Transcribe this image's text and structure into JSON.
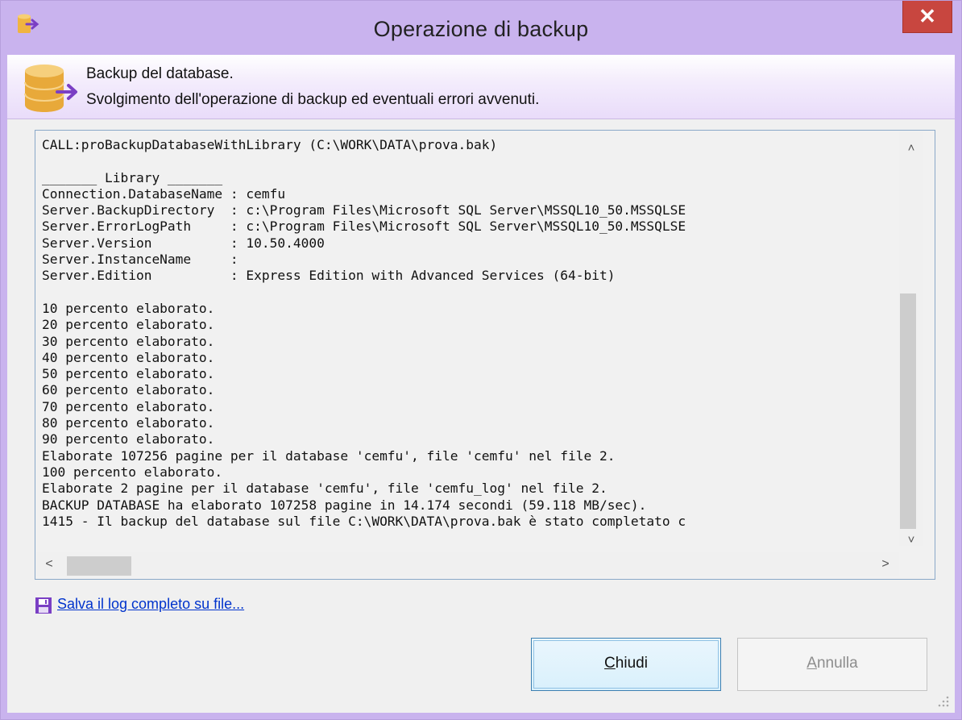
{
  "window": {
    "title": "Operazione di backup",
    "close_label": "✕"
  },
  "header": {
    "title": "Backup del database.",
    "subtitle": "Svolgimento dell'operazione di backup ed eventuali errori avvenuti."
  },
  "log": {
    "text": "CALL:proBackupDatabaseWithLibrary (C:\\WORK\\DATA\\prova.bak)\n\n_______ Library _______\nConnection.DatabaseName : cemfu\nServer.BackupDirectory  : c:\\Program Files\\Microsoft SQL Server\\MSSQL10_50.MSSQLSE\nServer.ErrorLogPath     : c:\\Program Files\\Microsoft SQL Server\\MSSQL10_50.MSSQLSE\nServer.Version          : 10.50.4000\nServer.InstanceName     :\nServer.Edition          : Express Edition with Advanced Services (64-bit)\n\n10 percento elaborato.\n20 percento elaborato.\n30 percento elaborato.\n40 percento elaborato.\n50 percento elaborato.\n60 percento elaborato.\n70 percento elaborato.\n80 percento elaborato.\n90 percento elaborato.\nElaborate 107256 pagine per il database 'cemfu', file 'cemfu' nel file 2.\n100 percento elaborato.\nElaborate 2 pagine per il database 'cemfu', file 'cemfu_log' nel file 2.\nBACKUP DATABASE ha elaborato 107258 pagine in 14.174 secondi (59.118 MB/sec).\n1415 - Il backup del database sul file C:\\WORK\\DATA\\prova.bak è stato completato c"
  },
  "scrollbars": {
    "up": "˄",
    "down": "˅",
    "left": "<",
    "right": ">"
  },
  "save_link": "Salva il log completo su file...",
  "buttons": {
    "close_hotkey": "C",
    "close_rest": "hiudi",
    "cancel_hotkey": "A",
    "cancel_rest": "nnulla"
  },
  "colors": {
    "titlebar": "#c9b3ee",
    "close": "#c8463f",
    "link": "#0033cc"
  }
}
